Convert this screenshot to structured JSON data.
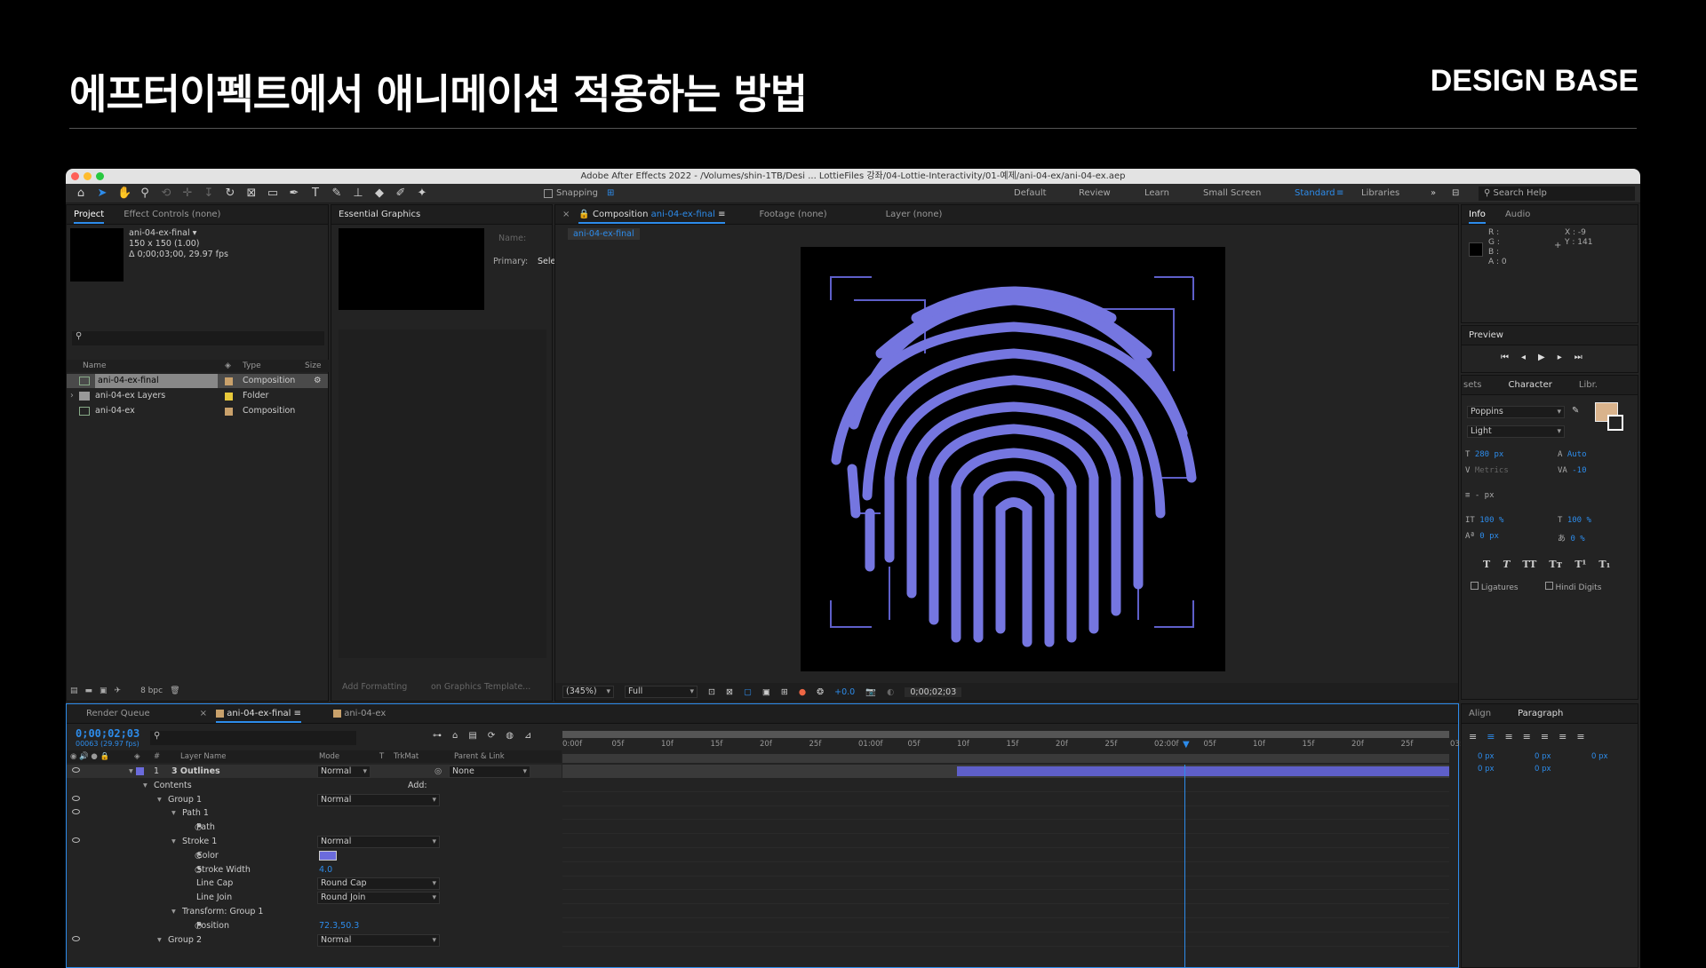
{
  "slide": {
    "title": "에프터이펙트에서 애니메이션 적용하는 방법",
    "brand": "DESIGN BASE"
  },
  "window": {
    "title": "Adobe After Effects 2022 - /Volumes/shin-1TB/Desi ... LottieFiles 강좌/04-Lottie-Interactivity/01-예제/ani-04-ex/ani-04-ex.aep"
  },
  "toolbar": {
    "snapping": "Snapping",
    "workspaces": [
      "Default",
      "Review",
      "Learn",
      "Small Screen",
      "Standard",
      "Libraries"
    ],
    "search_help": "Search Help"
  },
  "project": {
    "tabs": [
      "Project",
      "Effect Controls (none)"
    ],
    "selected_name": "ani-04-ex-final ▾",
    "selected_size": "150 x 150 (1.00)",
    "selected_duration": "Δ 0;00;03;00, 29.97 fps",
    "columns": {
      "name": "Name",
      "type": "Type",
      "size": "Size"
    },
    "items": [
      {
        "name": "ani-04-ex-final",
        "type": "Composition",
        "color": "#c9a16b"
      },
      {
        "name": "ani-04-ex Layers",
        "type": "Folder",
        "color": "#e8c93a"
      },
      {
        "name": "ani-04-ex",
        "type": "Composition",
        "color": "#c9a16b"
      }
    ],
    "bpc": "8 bpc"
  },
  "essential": {
    "tab": "Essential Graphics",
    "name_label": "Name:",
    "primary_label": "Primary:",
    "primary_value": "Sele",
    "add_formatting": "Add Formatting",
    "template": "on Graphics Template..."
  },
  "viewer": {
    "comp_tab_prefix": "Composition",
    "comp_tab_name": "ani-04-ex-final",
    "footage_tab": "Footage (none)",
    "layer_tab": "Layer (none)",
    "breadcrumb": "ani-04-ex-final",
    "zoom": "(345%)",
    "resolution": "Full",
    "exposure": "+0.0",
    "timecode": "0;00;02;03"
  },
  "info": {
    "tabs": [
      "Info",
      "Audio"
    ],
    "r": "R :",
    "g": "G :",
    "b": "B :",
    "a": "A : 0",
    "x": "X : -9",
    "y": "Y : 141"
  },
  "preview": {
    "tab": "Preview"
  },
  "character": {
    "tabs": [
      "sets",
      "Character",
      "Libr."
    ],
    "font": "Poppins",
    "style": "Light",
    "size": "280 px",
    "leading": "Auto",
    "kerning": "Metrics",
    "tracking": "-10",
    "stroke": "- px",
    "vscale": "100 %",
    "hscale": "100 %",
    "baseline": "0 px",
    "tsume": "0 %",
    "styles": [
      "T",
      "T",
      "TT",
      "Tт",
      "T¹",
      "T₁"
    ],
    "ligatures": "Ligatures",
    "hindi": "Hindi Digits",
    "fill_color": "#d9b38c"
  },
  "paragraph": {
    "tabs": [
      "Align",
      "Paragraph"
    ],
    "values": [
      "0 px",
      "0 px",
      "0 px",
      "0 px",
      "0 px"
    ]
  },
  "timeline": {
    "tabs": [
      "Render Queue",
      "ani-04-ex-final",
      "ani-04-ex"
    ],
    "timecode": "0;00;02;03",
    "frames": "00063 (29.97 fps)",
    "columns": {
      "num": "#",
      "name": "Layer Name",
      "mode": "Mode",
      "t": "T",
      "trkmat": "TrkMat",
      "parent": "Parent & Link"
    },
    "ruler": [
      "0:00f",
      "05f",
      "10f",
      "15f",
      "20f",
      "25f",
      "01:00f",
      "05f",
      "10f",
      "15f",
      "20f",
      "25f",
      "02:00f",
      "05f",
      "10f",
      "15f",
      "20f",
      "25f",
      "03:0"
    ],
    "rows": [
      {
        "indent": 0,
        "num": "1",
        "label": "3 Outlines",
        "mode": "Normal",
        "parent": "None"
      },
      {
        "indent": 1,
        "label": "Contents",
        "extra": "Add:"
      },
      {
        "indent": 2,
        "label": "Group 1",
        "mode": "Normal"
      },
      {
        "indent": 3,
        "label": "Path 1"
      },
      {
        "indent": 4,
        "label": "Path"
      },
      {
        "indent": 3,
        "label": "Stroke 1",
        "mode": "Normal"
      },
      {
        "indent": 4,
        "label": "Color"
      },
      {
        "indent": 4,
        "label": "Stroke Width",
        "value": "4.0"
      },
      {
        "indent": 4,
        "label": "Line Cap",
        "mode": "Round Cap"
      },
      {
        "indent": 4,
        "label": "Line Join",
        "mode": "Round Join"
      },
      {
        "indent": 3,
        "label": "Transform: Group 1"
      },
      {
        "indent": 4,
        "label": "Position",
        "value": "72.3,50.3"
      },
      {
        "indent": 2,
        "label": "Group 2",
        "mode": "Normal"
      }
    ]
  }
}
